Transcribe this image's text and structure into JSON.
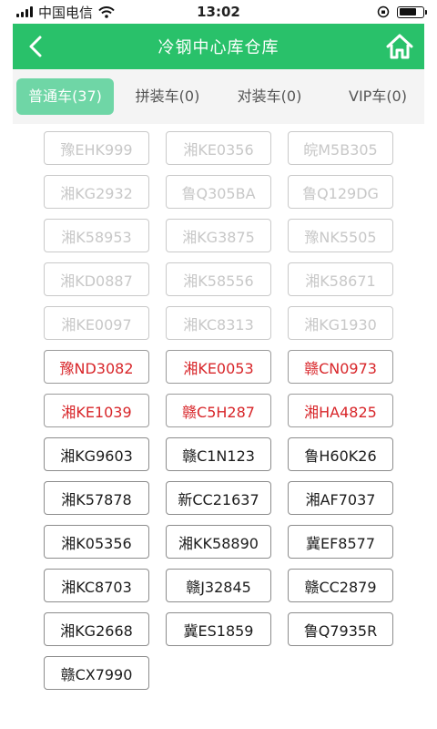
{
  "status_bar": {
    "carrier": "中国电信",
    "time": "13:02"
  },
  "nav": {
    "title": "冷钢中心库仓库",
    "back_icon": "chevron-left-icon",
    "home_icon": "home-icon"
  },
  "tabs": [
    {
      "label": "普通车(37)",
      "active": true
    },
    {
      "label": "拼装车(0)",
      "active": false
    },
    {
      "label": "对装车(0)",
      "active": false
    },
    {
      "label": "VIP车(0)",
      "active": false
    }
  ],
  "colors": {
    "brand_green": "#29c16a",
    "active_tab": "#6fd6a6",
    "gray_text": "#c8c8c8",
    "red_text": "#d8262a",
    "black_text": "#1c1c1c"
  },
  "plates": [
    {
      "text": "豫EHK999",
      "style": "gray"
    },
    {
      "text": "湘KE0356",
      "style": "gray"
    },
    {
      "text": "皖M5B305",
      "style": "gray"
    },
    {
      "text": "湘KG2932",
      "style": "gray"
    },
    {
      "text": "鲁Q305BA",
      "style": "gray"
    },
    {
      "text": "鲁Q129DG",
      "style": "gray"
    },
    {
      "text": "湘K58953",
      "style": "gray"
    },
    {
      "text": "湘KG3875",
      "style": "gray"
    },
    {
      "text": "豫NK5505",
      "style": "gray"
    },
    {
      "text": "湘KD0887",
      "style": "gray"
    },
    {
      "text": "湘K58556",
      "style": "gray"
    },
    {
      "text": "湘K58671",
      "style": "gray"
    },
    {
      "text": "湘KE0097",
      "style": "gray"
    },
    {
      "text": "湘KC8313",
      "style": "gray"
    },
    {
      "text": "湘KG1930",
      "style": "gray"
    },
    {
      "text": "豫ND3082",
      "style": "red"
    },
    {
      "text": "湘KE0053",
      "style": "red"
    },
    {
      "text": "赣CN0973",
      "style": "red"
    },
    {
      "text": "湘KE1039",
      "style": "red"
    },
    {
      "text": "赣C5H287",
      "style": "red"
    },
    {
      "text": "湘HA4825",
      "style": "red"
    },
    {
      "text": "湘KG9603",
      "style": "black"
    },
    {
      "text": "赣C1N123",
      "style": "black"
    },
    {
      "text": "鲁H60K26",
      "style": "black"
    },
    {
      "text": "湘K57878",
      "style": "black"
    },
    {
      "text": "新CC21637",
      "style": "black"
    },
    {
      "text": "湘AF7037",
      "style": "black"
    },
    {
      "text": "湘K05356",
      "style": "black"
    },
    {
      "text": "湘KK58890",
      "style": "black"
    },
    {
      "text": "冀EF8577",
      "style": "black"
    },
    {
      "text": "湘KC8703",
      "style": "black"
    },
    {
      "text": "赣J32845",
      "style": "black"
    },
    {
      "text": "赣CC2879",
      "style": "black"
    },
    {
      "text": "湘KG2668",
      "style": "black"
    },
    {
      "text": "冀ES1859",
      "style": "black"
    },
    {
      "text": "鲁Q7935R",
      "style": "black"
    },
    {
      "text": "赣CX7990",
      "style": "black"
    }
  ]
}
